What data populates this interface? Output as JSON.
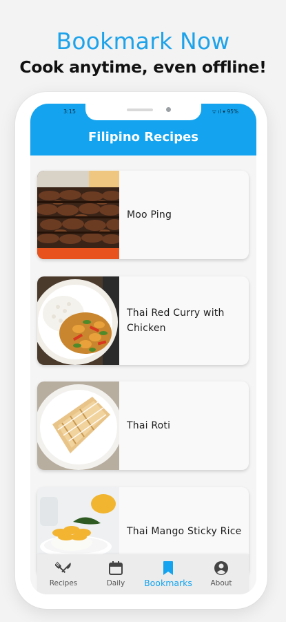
{
  "promo": {
    "headline": "Bookmark Now",
    "subline": "Cook anytime, even offline!"
  },
  "status_bar": {
    "time": "3:15",
    "icons": "ᯤ ıl ▾ 95%"
  },
  "app_bar": {
    "title": "Filipino Recipes"
  },
  "recipes": [
    {
      "title": "Moo Ping"
    },
    {
      "title": "Thai Red Curry with Chicken"
    },
    {
      "title": "Thai Roti"
    },
    {
      "title": "Thai Mango Sticky Rice"
    }
  ],
  "bottom_nav": {
    "items": [
      {
        "label": "Recipes",
        "icon": "fork-knife-icon"
      },
      {
        "label": "Daily",
        "icon": "calendar-icon"
      },
      {
        "label": "Bookmarks",
        "icon": "bookmark-icon",
        "active": true
      },
      {
        "label": "About",
        "icon": "account-icon"
      }
    ]
  },
  "colors": {
    "accent": "#14a4ef",
    "headline": "#1ea3ea",
    "background": "#f3f3f3",
    "card": "#f9f9f9"
  }
}
